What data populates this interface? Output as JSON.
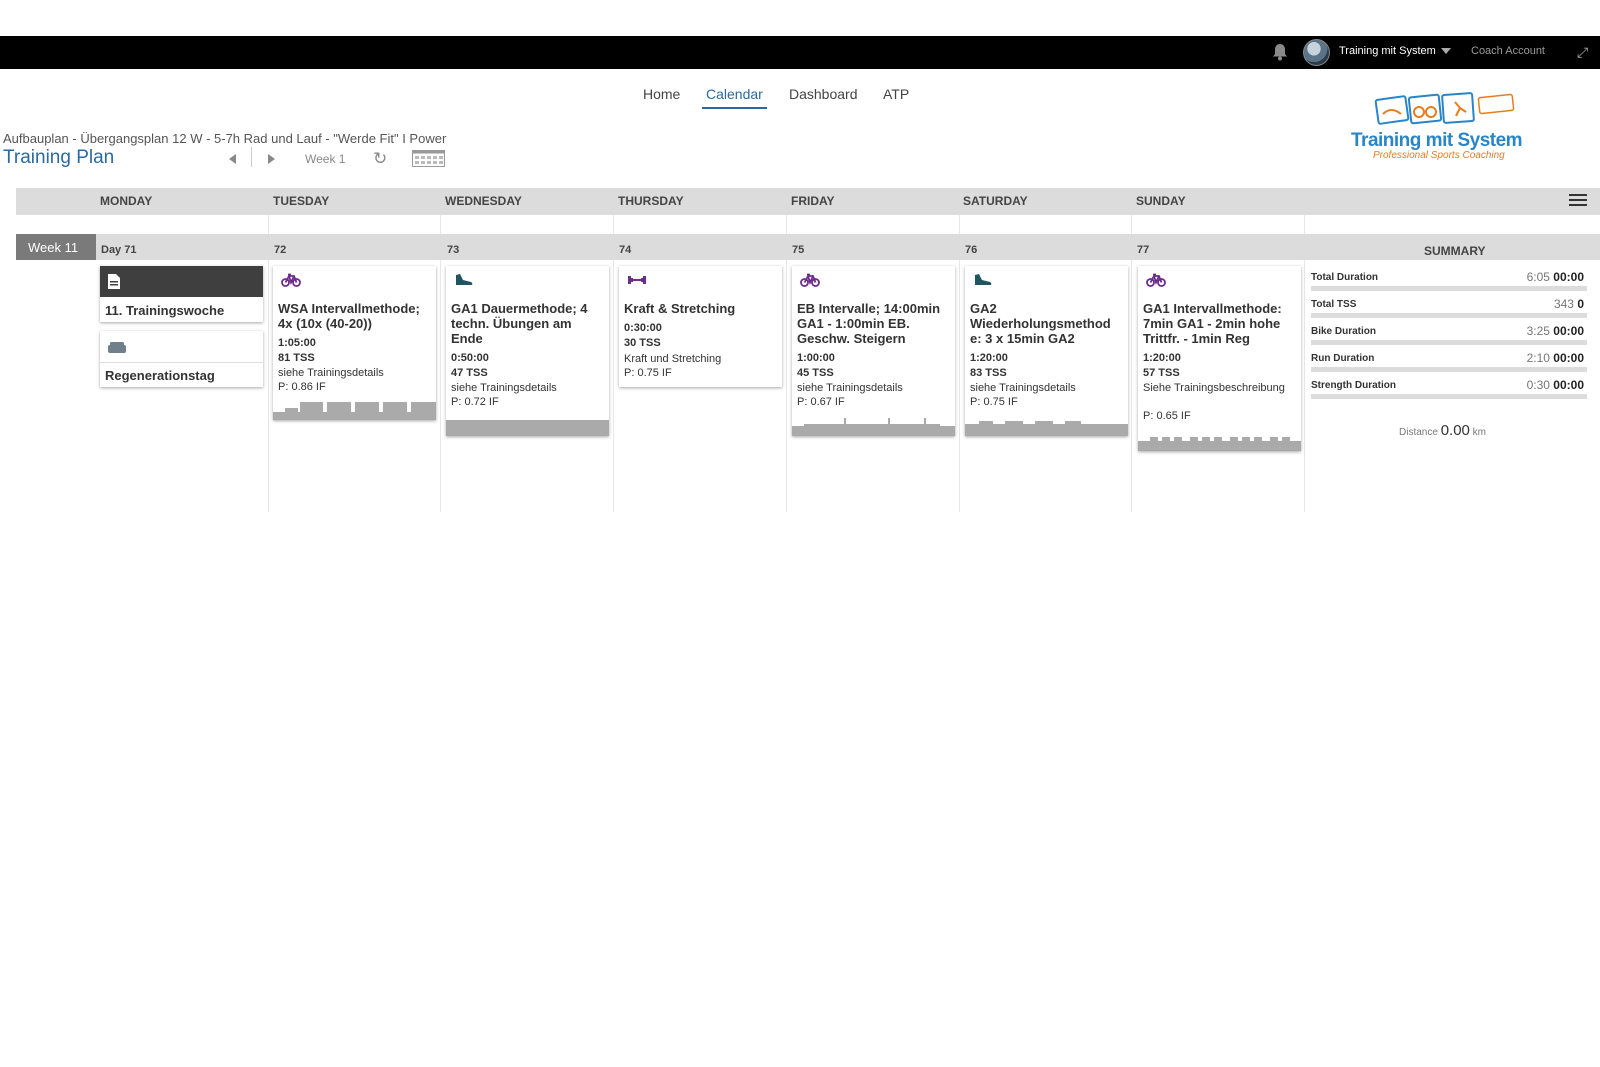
{
  "topbar": {
    "user": "Training mit System",
    "account": "Coach Account"
  },
  "nav": [
    "Home",
    "Calendar",
    "Dashboard",
    "ATP"
  ],
  "logo": {
    "text": "Training mit System",
    "sub": "Professional Sports Coaching"
  },
  "plan": {
    "subtitle": "Aufbauplan - Übergangsplan 12 W - 5-7h Rad und Lauf - \"Werde Fit\" I Power",
    "title": "Training Plan",
    "week": "Week 1"
  },
  "days": [
    "MONDAY",
    "TUESDAY",
    "WEDNESDAY",
    "THURSDAY",
    "FRIDAY",
    "SATURDAY",
    "SUNDAY"
  ],
  "week_label": "Week 11",
  "day_numbers": [
    "Day 71",
    "72",
    "73",
    "74",
    "75",
    "76",
    "77"
  ],
  "summary_title": "SUMMARY",
  "notes": [
    {
      "title": "11. Trainingswoche",
      "icon": "document-icon"
    },
    {
      "title": "Regenerationstag",
      "icon": "bed-icon"
    }
  ],
  "workouts": [
    {
      "type": "bike",
      "title": "WSA Intervallmethode; 4x (10x (40-20))",
      "duration": "1:05:00",
      "tss": "81 TSS",
      "desc": "siehe Trainingsdetails",
      "if": "P: 0.86 IF"
    },
    {
      "type": "run",
      "title": "GA1 Dauermethode; 4 techn. Übungen am Ende",
      "duration": "0:50:00",
      "tss": "47 TSS",
      "desc": "siehe Trainingsdetails",
      "if": "P: 0.72 IF"
    },
    {
      "type": "strength",
      "title": "Kraft & Stretching",
      "duration": "0:30:00",
      "tss": "30 TSS",
      "desc": "Kraft und Stretching",
      "if": "P: 0.75 IF"
    },
    {
      "type": "bike",
      "title": "EB Intervalle; 14:00min GA1 - 1:00min  EB. Geschw. Steigern",
      "duration": "1:00:00",
      "tss": "45 TSS",
      "desc": "siehe Trainingsdetails",
      "if": "P: 0.67 IF"
    },
    {
      "type": "run",
      "title": "GA2 Wiederholungsmethod e: 3 x 15min GA2",
      "duration": "1:20:00",
      "tss": "83 TSS",
      "desc": "siehe Trainingsdetails",
      "if": "P: 0.75 IF"
    },
    {
      "type": "bike",
      "title": "GA1 Intervallmethode: 7min GA1 - 2min hohe Trittfr. - 1min Reg",
      "duration": "1:20:00",
      "tss": "57 TSS",
      "desc": "Siehe Trainingsbeschreibung",
      "if": "P: 0.65 IF"
    }
  ],
  "summary": [
    {
      "label": "Total Duration",
      "planned": "6:05",
      "done": "00:00"
    },
    {
      "label": "Total TSS",
      "planned": "343",
      "done": "0"
    },
    {
      "label": "Bike Duration",
      "planned": "3:25",
      "done": "00:00"
    },
    {
      "label": "Run Duration",
      "planned": "2:10",
      "done": "00:00"
    },
    {
      "label": "Strength Duration",
      "planned": "0:30",
      "done": "00:00"
    }
  ],
  "distance": {
    "label": "Distance",
    "value": "0.00",
    "unit": "km"
  },
  "colors": {
    "accent": "#2a6aa0",
    "bike_icon": "#6b2d8a",
    "run_icon": "#1f5560",
    "strength_icon": "#6b2d8a"
  }
}
